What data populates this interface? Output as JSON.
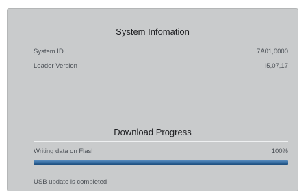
{
  "system_info": {
    "title": "System Infomation",
    "rows": [
      {
        "label": "System ID",
        "value": "7A01,0000"
      },
      {
        "label": "Loader Version",
        "value": "i5,07,17"
      }
    ]
  },
  "download_progress": {
    "title": "Download Progress",
    "status_text": "Writing data on Flash",
    "percent_text": "100%",
    "progress": 1.0,
    "completion_message": "USB update is completed"
  },
  "colors": {
    "panel_bg": "#c9cbcc",
    "progress_fill": "#2f679b",
    "text_label": "#4b5056",
    "text_title": "#1e1f22"
  }
}
